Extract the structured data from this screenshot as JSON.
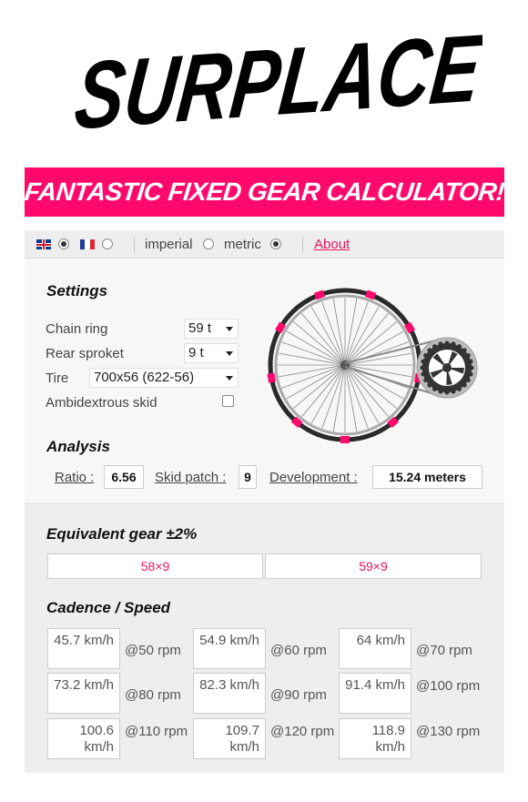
{
  "logo_text": "SURPLACE",
  "banner_text": "FANTASTIC FIXED GEAR CALCULATOR!",
  "toolbar": {
    "lang_en_selected": true,
    "lang_fr_selected": false,
    "imperial_label": "imperial",
    "metric_label": "metric",
    "unit_selected": "metric",
    "about_label": "About"
  },
  "settings": {
    "title": "Settings",
    "chain_ring_label": "Chain ring",
    "chain_ring_value": "59 t",
    "rear_sprocket_label": "Rear sproket",
    "rear_sprocket_value": "9 t",
    "tire_label": "Tire",
    "tire_value": "700x56 (622-56)",
    "ambidextrous_label": "Ambidextrous skid",
    "ambidextrous_checked": false
  },
  "analysis": {
    "title": "Analysis",
    "ratio_label": "Ratio :",
    "ratio_value": "6.56",
    "skid_label": "Skid patch :",
    "skid_value": "9",
    "development_label": "Development :",
    "development_value": "15.24 meters"
  },
  "equivalent": {
    "title": "Equivalent gear ±2%",
    "gears": [
      "58×9",
      "59×9"
    ]
  },
  "cadence": {
    "title": "Cadence / Speed",
    "rows": [
      [
        {
          "speed": "45.7 km/h",
          "rpm": "@50 rpm"
        },
        {
          "speed": "54.9 km/h",
          "rpm": "@60 rpm"
        },
        {
          "speed": "64 km/h",
          "rpm": "@70 rpm"
        }
      ],
      [
        {
          "speed": "73.2 km/h",
          "rpm": "@80 rpm"
        },
        {
          "speed": "82.3 km/h",
          "rpm": "@90 rpm"
        },
        {
          "speed": "91.4 km/h",
          "rpm": "@100 rpm"
        }
      ],
      [
        {
          "speed": "100.6 km/h",
          "rpm": "@110 rpm"
        },
        {
          "speed": "109.7 km/h",
          "rpm": "@120 rpm"
        },
        {
          "speed": "118.9 km/h",
          "rpm": "@130 rpm"
        }
      ]
    ]
  },
  "colors": {
    "accent": "#ff0a6c",
    "link": "#e8175d",
    "flag_fr": [
      "#1f3f9a",
      "#ffffff",
      "#e0262f"
    ]
  },
  "icons": {
    "flag_en": "uk-flag-icon",
    "flag_fr": "fr-flag-icon",
    "wheel": "wheel-illustration"
  }
}
